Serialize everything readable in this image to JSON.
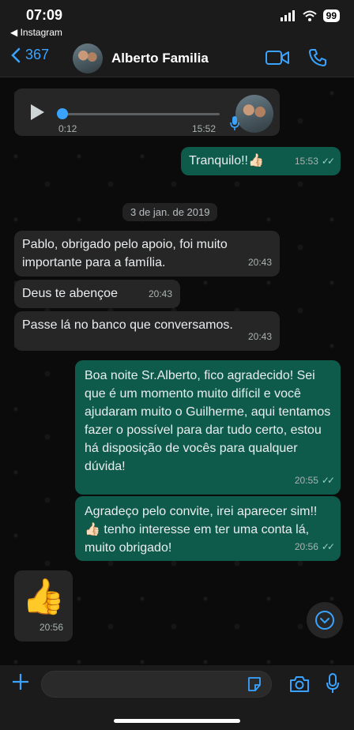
{
  "status": {
    "time": "07:09",
    "back_app": "◀ Instagram",
    "battery": "99"
  },
  "header": {
    "back_count": "367",
    "contact_name": "Alberto Familia"
  },
  "audio": {
    "duration": "0:12",
    "time": "15:52"
  },
  "messages": [
    {
      "text": "Tranquilo!!👍🏻",
      "time": "15:53",
      "dir": "out"
    },
    {
      "text": "Pablo, obrigado pelo apoio, foi muito importante para a família.",
      "time": "20:43",
      "dir": "in"
    },
    {
      "text": "Deus te abençoe",
      "time": "20:43",
      "dir": "in"
    },
    {
      "text": "Passe lá no banco que conversamos.",
      "time": "20:43",
      "dir": "in"
    },
    {
      "text": "Boa noite Sr.Alberto, fico agradecido! Sei que é um momento muito difícil e você ajudaram muito o Guilherme, aqui tentamos fazer o possível para dar tudo certo, estou há disposição de vocês para qualquer dúvida!",
      "time": "20:55",
      "dir": "out"
    },
    {
      "text": "Agradeço pelo convite, irei aparecer sim!! 👍🏻 tenho interesse em ter uma conta lá, muito obrigado!",
      "time": "20:56",
      "dir": "out"
    },
    {
      "text": "👍",
      "time": "20:56",
      "dir": "in"
    }
  ],
  "date_separator": "3 de jan. de 2019",
  "ticks": "✓✓",
  "colors": {
    "accent": "#3aa3ff",
    "outgoing": "#0f5b4b",
    "incoming": "#262626",
    "background": "#0b0b0b"
  }
}
